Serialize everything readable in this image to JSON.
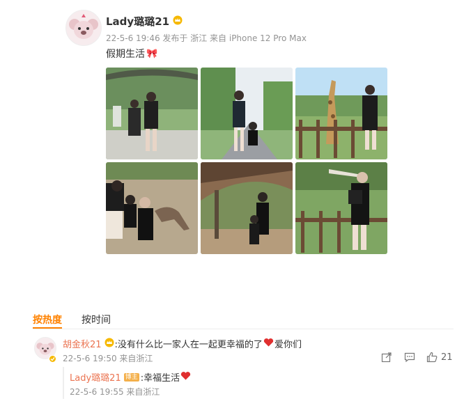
{
  "post": {
    "author": "Lady璐璐21",
    "meta": "22-5-6 19:46 发布于 浙江 来自 iPhone 12 Pro Max",
    "text": "假期生活",
    "emoji": "🎀"
  },
  "tabs": {
    "hot": "按热度",
    "time": "按时间"
  },
  "comment": {
    "author": "胡金秋21",
    "text": ":没有什么比一家人在一起更幸福的了",
    "text_end": "爱你们",
    "meta": "22-5-6 19:50 来自浙江",
    "likes": "21"
  },
  "reply": {
    "author": "Lady璐璐21",
    "badge": "博主",
    "text": ":幸福生活",
    "meta": "22-5-6 19:55 来自浙江"
  },
  "icons": {
    "crown": "crown-badge-icon",
    "heart": "red-heart-icon",
    "share": "share-icon",
    "comment": "comment-icon",
    "like": "thumbs-up-icon",
    "verified": "verified-badge-icon"
  },
  "colors": {
    "accent": "#ff8200",
    "commenter": "#eb7350",
    "meta": "#939393",
    "heart": "#e02f2f"
  }
}
